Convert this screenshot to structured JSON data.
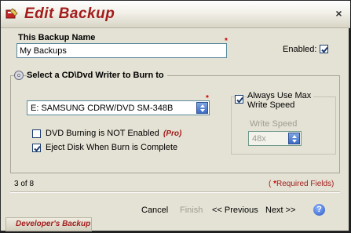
{
  "window": {
    "title": "Edit  Backup",
    "close_glyph": "×"
  },
  "backup_name": {
    "label": "This Backup Name",
    "required_mark": "*",
    "value": "My Backups"
  },
  "enabled": {
    "label": "Enabled:",
    "checked": true
  },
  "writer_section": {
    "title": "Select a CD\\Dvd Writer to Burn to",
    "icon": "disc-icon",
    "writer_select": {
      "value": "E: SAMSUNG CDRW/DVD SM-348B",
      "required_mark": "*"
    },
    "dvd_not_enabled": {
      "label": "DVD Burning is NOT Enabled",
      "checked": false,
      "badge": "(Pro)"
    },
    "eject_disk": {
      "label": "Eject Disk When Burn is Complete",
      "checked": true
    },
    "always_max_speed": {
      "label_line1": "Always Use Max",
      "label_line2": "Write Speed",
      "checked": true
    },
    "write_speed": {
      "label": "Write Speed",
      "value": "48x",
      "disabled": true
    }
  },
  "footer": {
    "step_count": "3 of 8",
    "required_note_open": "( ",
    "required_note_star": "*",
    "required_note_text": "Required Fields)",
    "cancel_label": "Cancel",
    "finish_label": "Finish",
    "previous_label": "<< Previous",
    "next_label": "Next >>",
    "help_glyph": "?"
  },
  "brand": {
    "label": "Developer's Backup"
  },
  "colors": {
    "accent_red": "#a21c1c",
    "panel_bg": "#e4e2d4",
    "checkbox_blue": "#1a3c6e"
  }
}
